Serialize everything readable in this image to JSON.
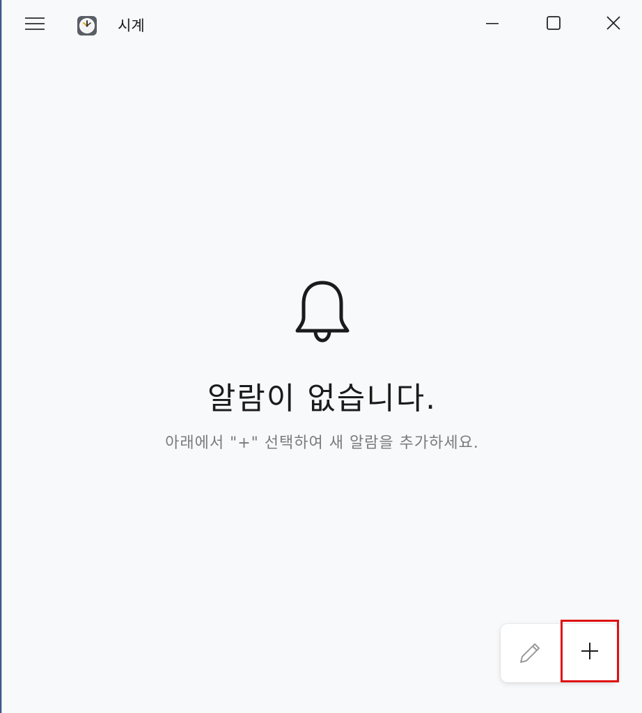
{
  "app": {
    "title": "시계",
    "icon": "clock-app-icon"
  },
  "titlebar": {
    "menu_icon": "hamburger-menu-icon",
    "minimize_icon": "minimize-icon",
    "maximize_icon": "maximize-icon",
    "close_icon": "close-icon"
  },
  "empty_state": {
    "icon": "bell-icon",
    "title": "알람이 없습니다.",
    "subtitle": "아래에서 \"+\" 선택하여 새 알람을 추가하세요."
  },
  "actions": {
    "edit_icon": "pencil-icon",
    "edit_enabled": false,
    "add_icon": "plus-icon",
    "highlight_color": "#e01010"
  }
}
